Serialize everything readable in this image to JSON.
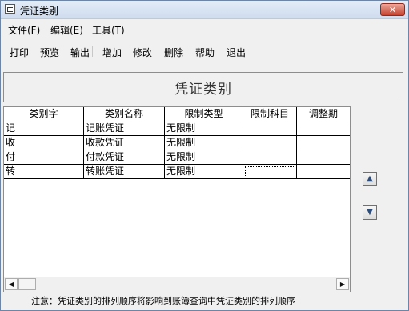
{
  "window": {
    "title": "凭证类别",
    "close_label": "✕"
  },
  "menu": [
    {
      "id": "file",
      "label": "文件(F)"
    },
    {
      "id": "edit",
      "label": "编辑(E)"
    },
    {
      "id": "tools",
      "label": "工具(T)"
    }
  ],
  "toolbar": [
    {
      "id": "print",
      "label": "打印"
    },
    {
      "id": "preview",
      "label": "预览"
    },
    {
      "id": "export",
      "label": "输出"
    },
    {
      "id": "add",
      "label": "增加"
    },
    {
      "id": "modify",
      "label": "修改"
    },
    {
      "id": "delete",
      "label": "删除"
    },
    {
      "id": "help",
      "label": "帮助"
    },
    {
      "id": "exit",
      "label": "退出"
    }
  ],
  "header": {
    "title": "凭证类别"
  },
  "table": {
    "columns": [
      "类别字",
      "类别名称",
      "限制类型",
      "限制科目",
      "调整期"
    ],
    "rows": [
      [
        "记",
        "记账凭证",
        "无限制",
        "",
        ""
      ],
      [
        "收",
        "收款凭证",
        "无限制",
        "",
        ""
      ],
      [
        "付",
        "付款凭证",
        "无限制",
        "",
        ""
      ],
      [
        "转",
        "转账凭证",
        "无限制",
        "",
        ""
      ]
    ]
  },
  "scroll": {
    "left_arrow": "◀",
    "right_arrow": "▶"
  },
  "side_buttons": {
    "up": "▲",
    "down": "▼"
  },
  "note": "注意：凭证类别的排列顺序将影响到账簿查询中凭证类别的排列顺序"
}
